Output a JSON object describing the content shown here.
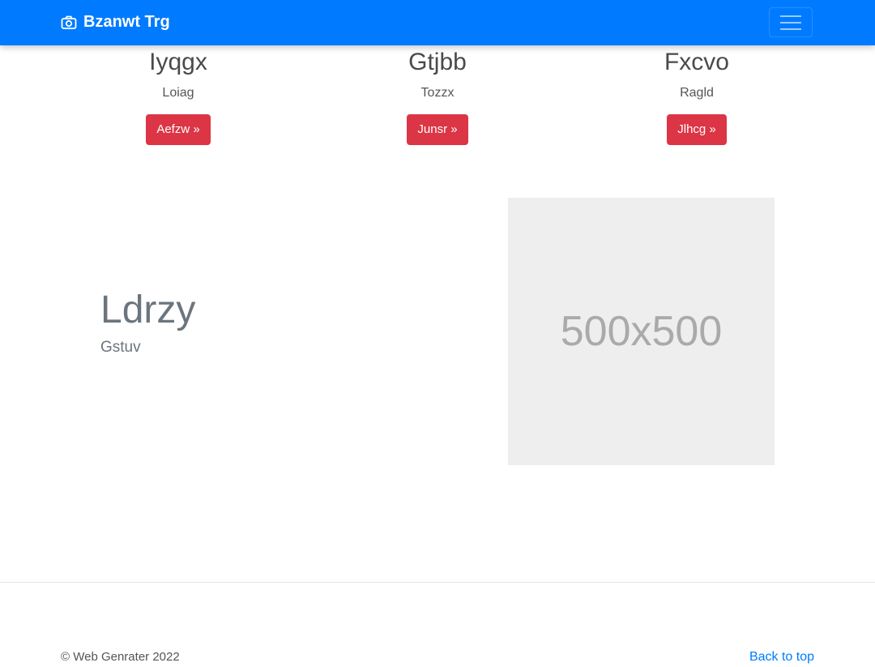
{
  "colors": {
    "navbar_bg": "#007bff",
    "button_bg": "#dc3545",
    "link": "#007bff",
    "placeholder_bg": "#eeeeee"
  },
  "navbar": {
    "brand_icon": "camera-icon",
    "brand": "Bzanwt Trg",
    "toggler_icon": "hamburger-menu-icon"
  },
  "features": [
    {
      "title": "Iyqgx",
      "text": "Loiag",
      "button": "Aefzw »"
    },
    {
      "title": "Gtjbb",
      "text": "Tozzx",
      "button": "Junsr »"
    },
    {
      "title": "Fxcvo",
      "text": "Ragld",
      "button": "Jlhcg »"
    }
  ],
  "hero": {
    "title": "Ldrzy",
    "subtitle": "Gstuv",
    "image_label": "500x500"
  },
  "footer": {
    "copyright": "© Web Genrater 2022",
    "back_to_top": "Back to top"
  }
}
